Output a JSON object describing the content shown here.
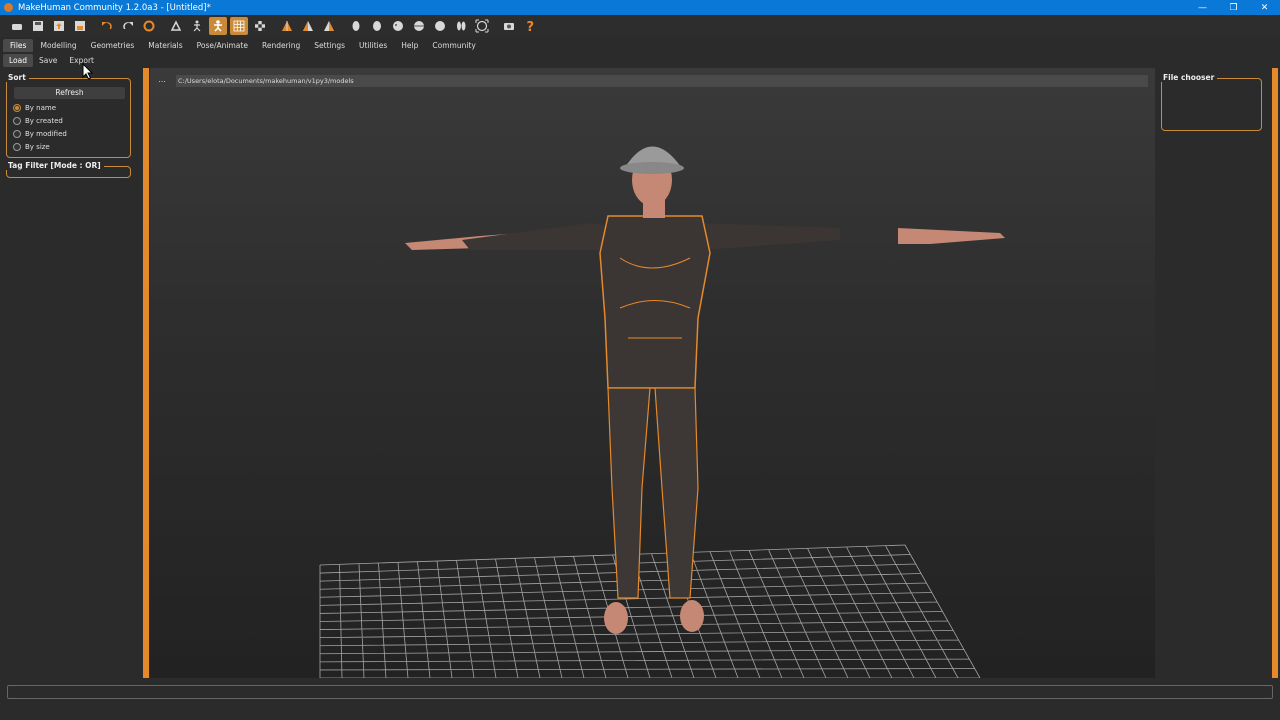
{
  "window": {
    "title": "MakeHuman Community 1.2.0a3 - [Untitled]*",
    "controls": [
      "—",
      "❐",
      "✕"
    ]
  },
  "toolbar": {
    "icons": [
      "new-icon",
      "save-icon",
      "export-icon",
      "save-disk-icon",
      "undo-icon",
      "redo-icon",
      "reset-icon",
      "pose-icon",
      "skeleton-icon",
      "smooth-icon",
      "wireframe-icon",
      "background-icon",
      "front-view-icon",
      "back-view-icon",
      "left-view-icon",
      "right-view-icon",
      "top-view-icon",
      "bottom-view-icon",
      "reset-camera-icon",
      "global-camera-icon",
      "grab-screen-icon",
      "help-icon"
    ],
    "active": [
      "smooth-icon",
      "wireframe-icon"
    ]
  },
  "menu_tabs": [
    "Files",
    "Modelling",
    "Geometries",
    "Materials",
    "Pose/Animate",
    "Rendering",
    "Settings",
    "Utilities",
    "Help",
    "Community"
  ],
  "menu_active": "Files",
  "sub_tabs": [
    "Load",
    "Save",
    "Export"
  ],
  "sub_active": "Load",
  "sort": {
    "title": "Sort",
    "refresh_label": "Refresh",
    "options": [
      "By name",
      "By created",
      "By modified",
      "By size"
    ],
    "selected": "By name"
  },
  "tag_filter": {
    "title": "Tag Filter [Mode : OR]"
  },
  "path": {
    "browse_label": "...",
    "value": "C:/Users/elota/Documents/makehuman/v1py3/models"
  },
  "file_chooser": {
    "title": "File chooser"
  },
  "colors": {
    "accent": "#e58a2b",
    "titlebar": "#0a78d7"
  }
}
